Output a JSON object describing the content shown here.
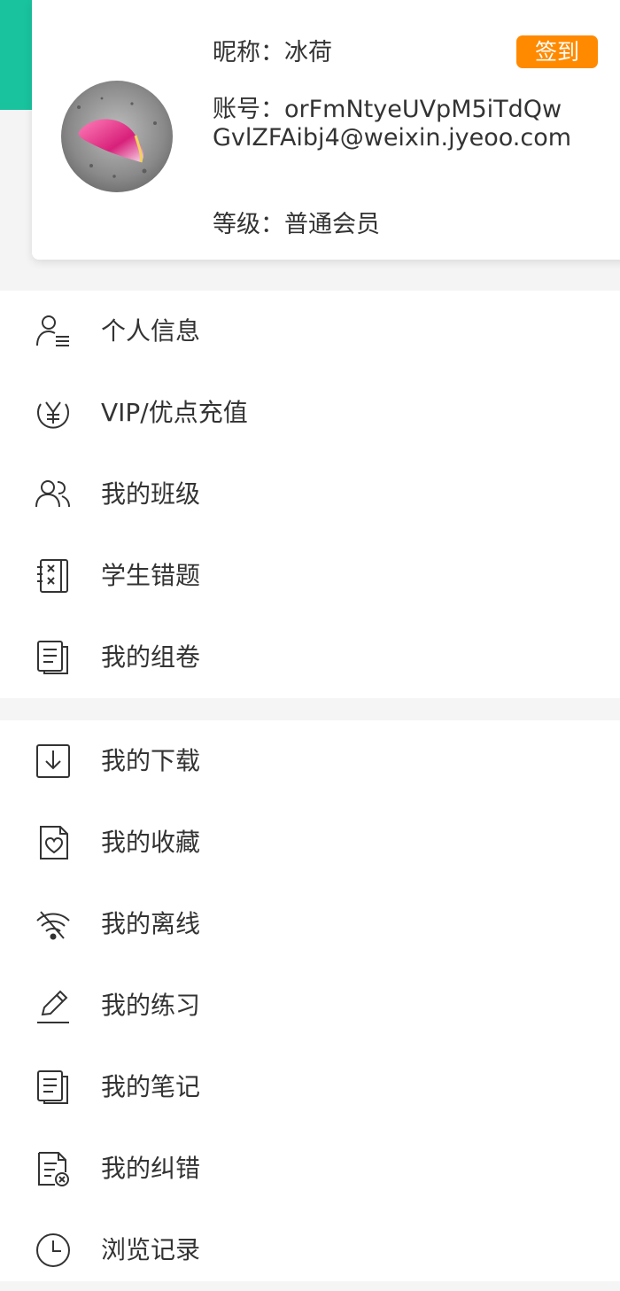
{
  "profile": {
    "nickname": "昵称：冰荷",
    "account": "账号：orFmNtyeUVpM5iTdQwGvlZFAibj4@weixin.jyeoo.com",
    "level": "等级：普通会员",
    "checkin_label": "签到"
  },
  "menu_group_1": [
    {
      "label": "个人信息",
      "icon": "user-list-icon"
    },
    {
      "label": "VIP/优点充值",
      "icon": "yen-circle-icon"
    },
    {
      "label": "我的班级",
      "icon": "users-icon"
    },
    {
      "label": "学生错题",
      "icon": "wrong-questions-icon"
    },
    {
      "label": "我的组卷",
      "icon": "document-icon"
    }
  ],
  "menu_group_2": [
    {
      "label": "我的下载",
      "icon": "download-icon"
    },
    {
      "label": "我的收藏",
      "icon": "favorite-heart-icon"
    },
    {
      "label": "我的离线",
      "icon": "offline-wifi-icon"
    },
    {
      "label": "我的练习",
      "icon": "pencil-icon"
    },
    {
      "label": "我的笔记",
      "icon": "notes-icon"
    },
    {
      "label": "我的纠错",
      "icon": "error-report-icon"
    },
    {
      "label": "浏览记录",
      "icon": "clock-icon"
    }
  ]
}
